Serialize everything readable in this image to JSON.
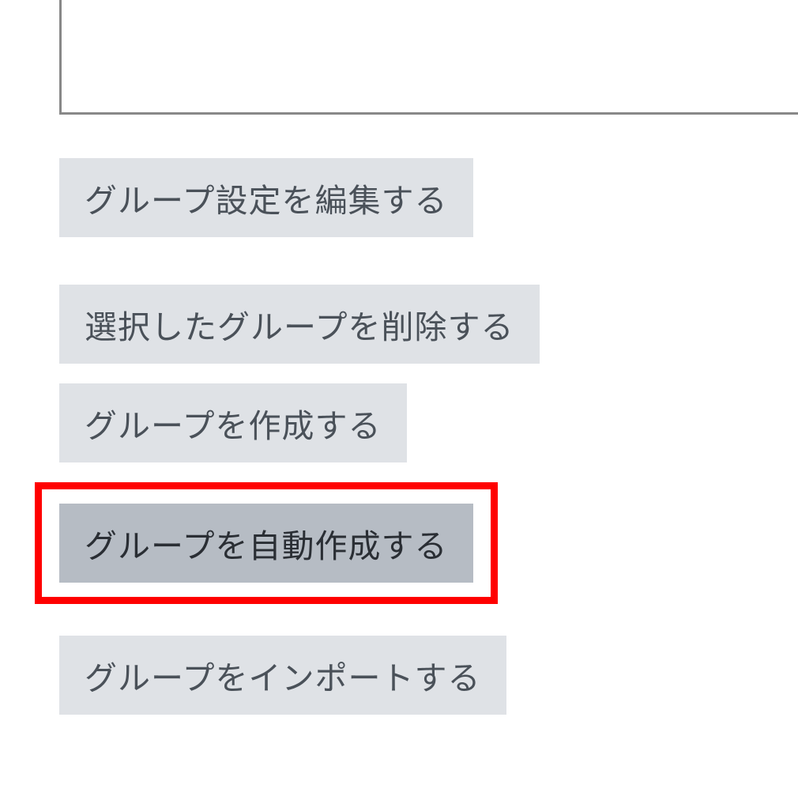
{
  "buttons": {
    "edit_settings": "グループ設定を編集する",
    "delete_selected": "選択したグループを削除する",
    "create_group": "グループを作成する",
    "auto_create_group": "グループを自動作成する",
    "import_group": "グループをインポートする"
  }
}
